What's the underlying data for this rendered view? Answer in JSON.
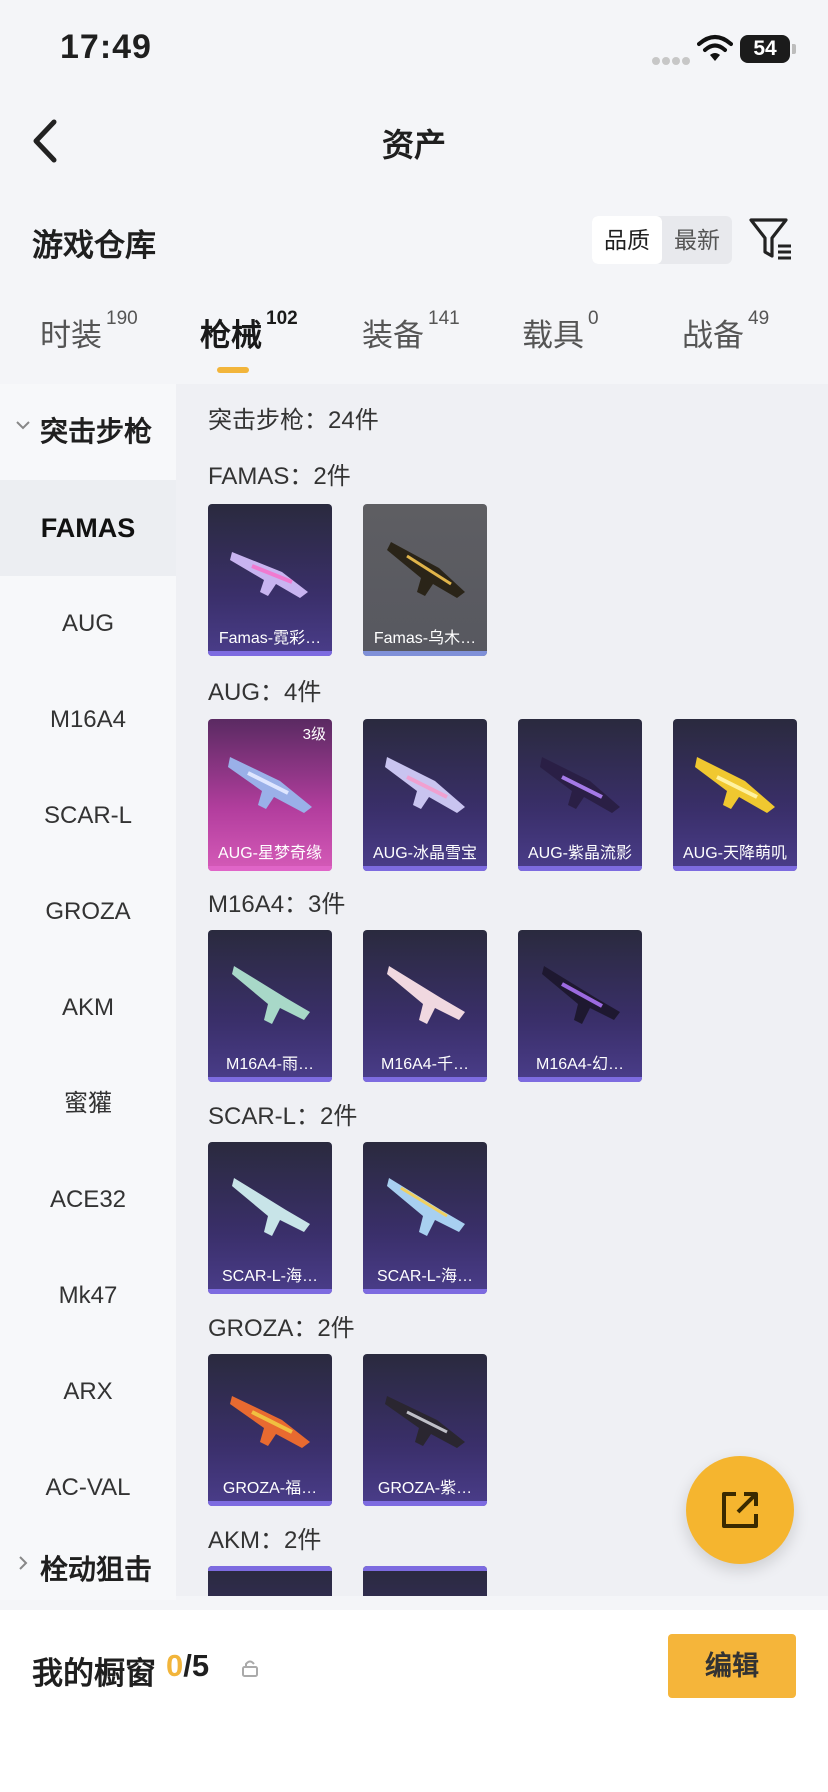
{
  "status_bar": {
    "time": "17:49",
    "battery": "54"
  },
  "nav": {
    "title": "资产"
  },
  "header": {
    "title": "游戏仓库",
    "sort_options": [
      "品质",
      "最新"
    ]
  },
  "tabs": [
    {
      "label": "时装",
      "count": "190"
    },
    {
      "label": "枪械",
      "count": "102"
    },
    {
      "label": "装备",
      "count": "141"
    },
    {
      "label": "载具",
      "count": "0"
    },
    {
      "label": "战备",
      "count": "49"
    }
  ],
  "sidebar": {
    "group_open": "突击步枪",
    "items": [
      "FAMAS",
      "AUG",
      "M16A4",
      "SCAR-L",
      "GROZA",
      "AKM",
      "蜜獾",
      "ACE32",
      "Mk47",
      "ARX",
      "AC-VAL"
    ],
    "group_closed": "栓动狙击"
  },
  "main": {
    "total": "突击步枪：24件",
    "groups": [
      {
        "title": "FAMAS：2件",
        "items": [
          "Famas-霓彩…",
          "Famas-乌木…"
        ]
      },
      {
        "title": "AUG：4件",
        "badge": "3级",
        "items": [
          "AUG-星梦奇缘",
          "AUG-冰晶雪宝",
          "AUG-紫晶流影",
          "AUG-天降萌叽"
        ]
      },
      {
        "title": "M16A4：3件",
        "items": [
          "M16A4-雨…",
          "M16A4-千…",
          "M16A4-幻…"
        ]
      },
      {
        "title": "SCAR-L：2件",
        "items": [
          "SCAR-L-海…",
          "SCAR-L-海…"
        ]
      },
      {
        "title": "GROZA：2件",
        "items": [
          "GROZA-福…",
          "GROZA-紫…"
        ]
      },
      {
        "title": "AKM：2件"
      }
    ]
  },
  "bottom": {
    "label": "我的橱窗",
    "used": "0",
    "total": "/5",
    "edit": "编辑"
  },
  "colors": {
    "accent": "#f5b53a",
    "card_bg": "#3a2f6a",
    "rare_card": "#b33e9e"
  }
}
